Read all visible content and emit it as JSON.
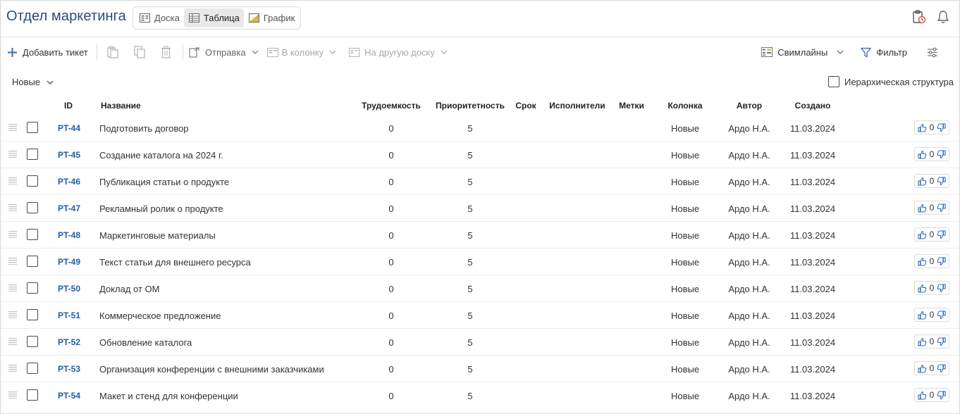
{
  "header": {
    "title": "Отдел маркетинга",
    "views": [
      {
        "label": "Доска",
        "active": false
      },
      {
        "label": "Таблица",
        "active": true
      },
      {
        "label": "График",
        "active": false
      }
    ]
  },
  "toolbar": {
    "add_ticket": "Добавить тикет",
    "send": "Отправка",
    "to_column": "В колонку",
    "to_board": "На другую доску",
    "swimlanes": "Свимлайны",
    "filter": "Фильтр"
  },
  "group": {
    "label": "Новые"
  },
  "hierarchy": {
    "label": "Иерархическая структура",
    "checked": false
  },
  "columns": {
    "id": "ID",
    "name": "Название",
    "effort": "Трудоемкость",
    "priority": "Приоритетность",
    "due": "Срок",
    "assignees": "Исполнители",
    "tags": "Метки",
    "column": "Колонка",
    "author": "Автор",
    "created": "Создано"
  },
  "rows": [
    {
      "id": "PT-44",
      "name": "Подготовить договор",
      "effort": "0",
      "priority": "5",
      "column": "Новые",
      "author": "Ардо Н.А.",
      "created": "11.03.2024",
      "votes": "0"
    },
    {
      "id": "PT-45",
      "name": "Создание каталога на 2024 г.",
      "effort": "0",
      "priority": "5",
      "column": "Новые",
      "author": "Ардо Н.А.",
      "created": "11.03.2024",
      "votes": "0"
    },
    {
      "id": "PT-46",
      "name": "Публикация статьи о продукте",
      "effort": "0",
      "priority": "5",
      "column": "Новые",
      "author": "Ардо Н.А.",
      "created": "11.03.2024",
      "votes": "0"
    },
    {
      "id": "PT-47",
      "name": "Рекламный ролик о продукте",
      "effort": "0",
      "priority": "5",
      "column": "Новые",
      "author": "Ардо Н.А.",
      "created": "11.03.2024",
      "votes": "0"
    },
    {
      "id": "PT-48",
      "name": "Маркетинговые материалы",
      "effort": "0",
      "priority": "5",
      "column": "Новые",
      "author": "Ардо Н.А.",
      "created": "11.03.2024",
      "votes": "0"
    },
    {
      "id": "PT-49",
      "name": "Текст статьи для внешнего ресурса",
      "effort": "0",
      "priority": "5",
      "column": "Новые",
      "author": "Ардо Н.А.",
      "created": "11.03.2024",
      "votes": "0"
    },
    {
      "id": "PT-50",
      "name": "Доклад от ОМ",
      "effort": "0",
      "priority": "5",
      "column": "Новые",
      "author": "Ардо Н.А.",
      "created": "11.03.2024",
      "votes": "0"
    },
    {
      "id": "PT-51",
      "name": "Коммерческое предложение",
      "effort": "0",
      "priority": "5",
      "column": "Новые",
      "author": "Ардо Н.А.",
      "created": "11.03.2024",
      "votes": "0"
    },
    {
      "id": "PT-52",
      "name": "Обновление каталога",
      "effort": "0",
      "priority": "5",
      "column": "Новые",
      "author": "Ардо Н.А.",
      "created": "11.03.2024",
      "votes": "0"
    },
    {
      "id": "PT-53",
      "name": "Организация конференции с внешними заказчиками",
      "effort": "0",
      "priority": "5",
      "column": "Новые",
      "author": "Ардо Н.А.",
      "created": "11.03.2024",
      "votes": "0"
    },
    {
      "id": "PT-54",
      "name": "Макет и стенд для конференции",
      "effort": "0",
      "priority": "5",
      "column": "Новые",
      "author": "Ардо Н.А.",
      "created": "11.03.2024",
      "votes": "0"
    }
  ],
  "colors": {
    "title": "#2c4b7a",
    "id_link": "#1f5ea8",
    "accent": "#2f6db3"
  }
}
